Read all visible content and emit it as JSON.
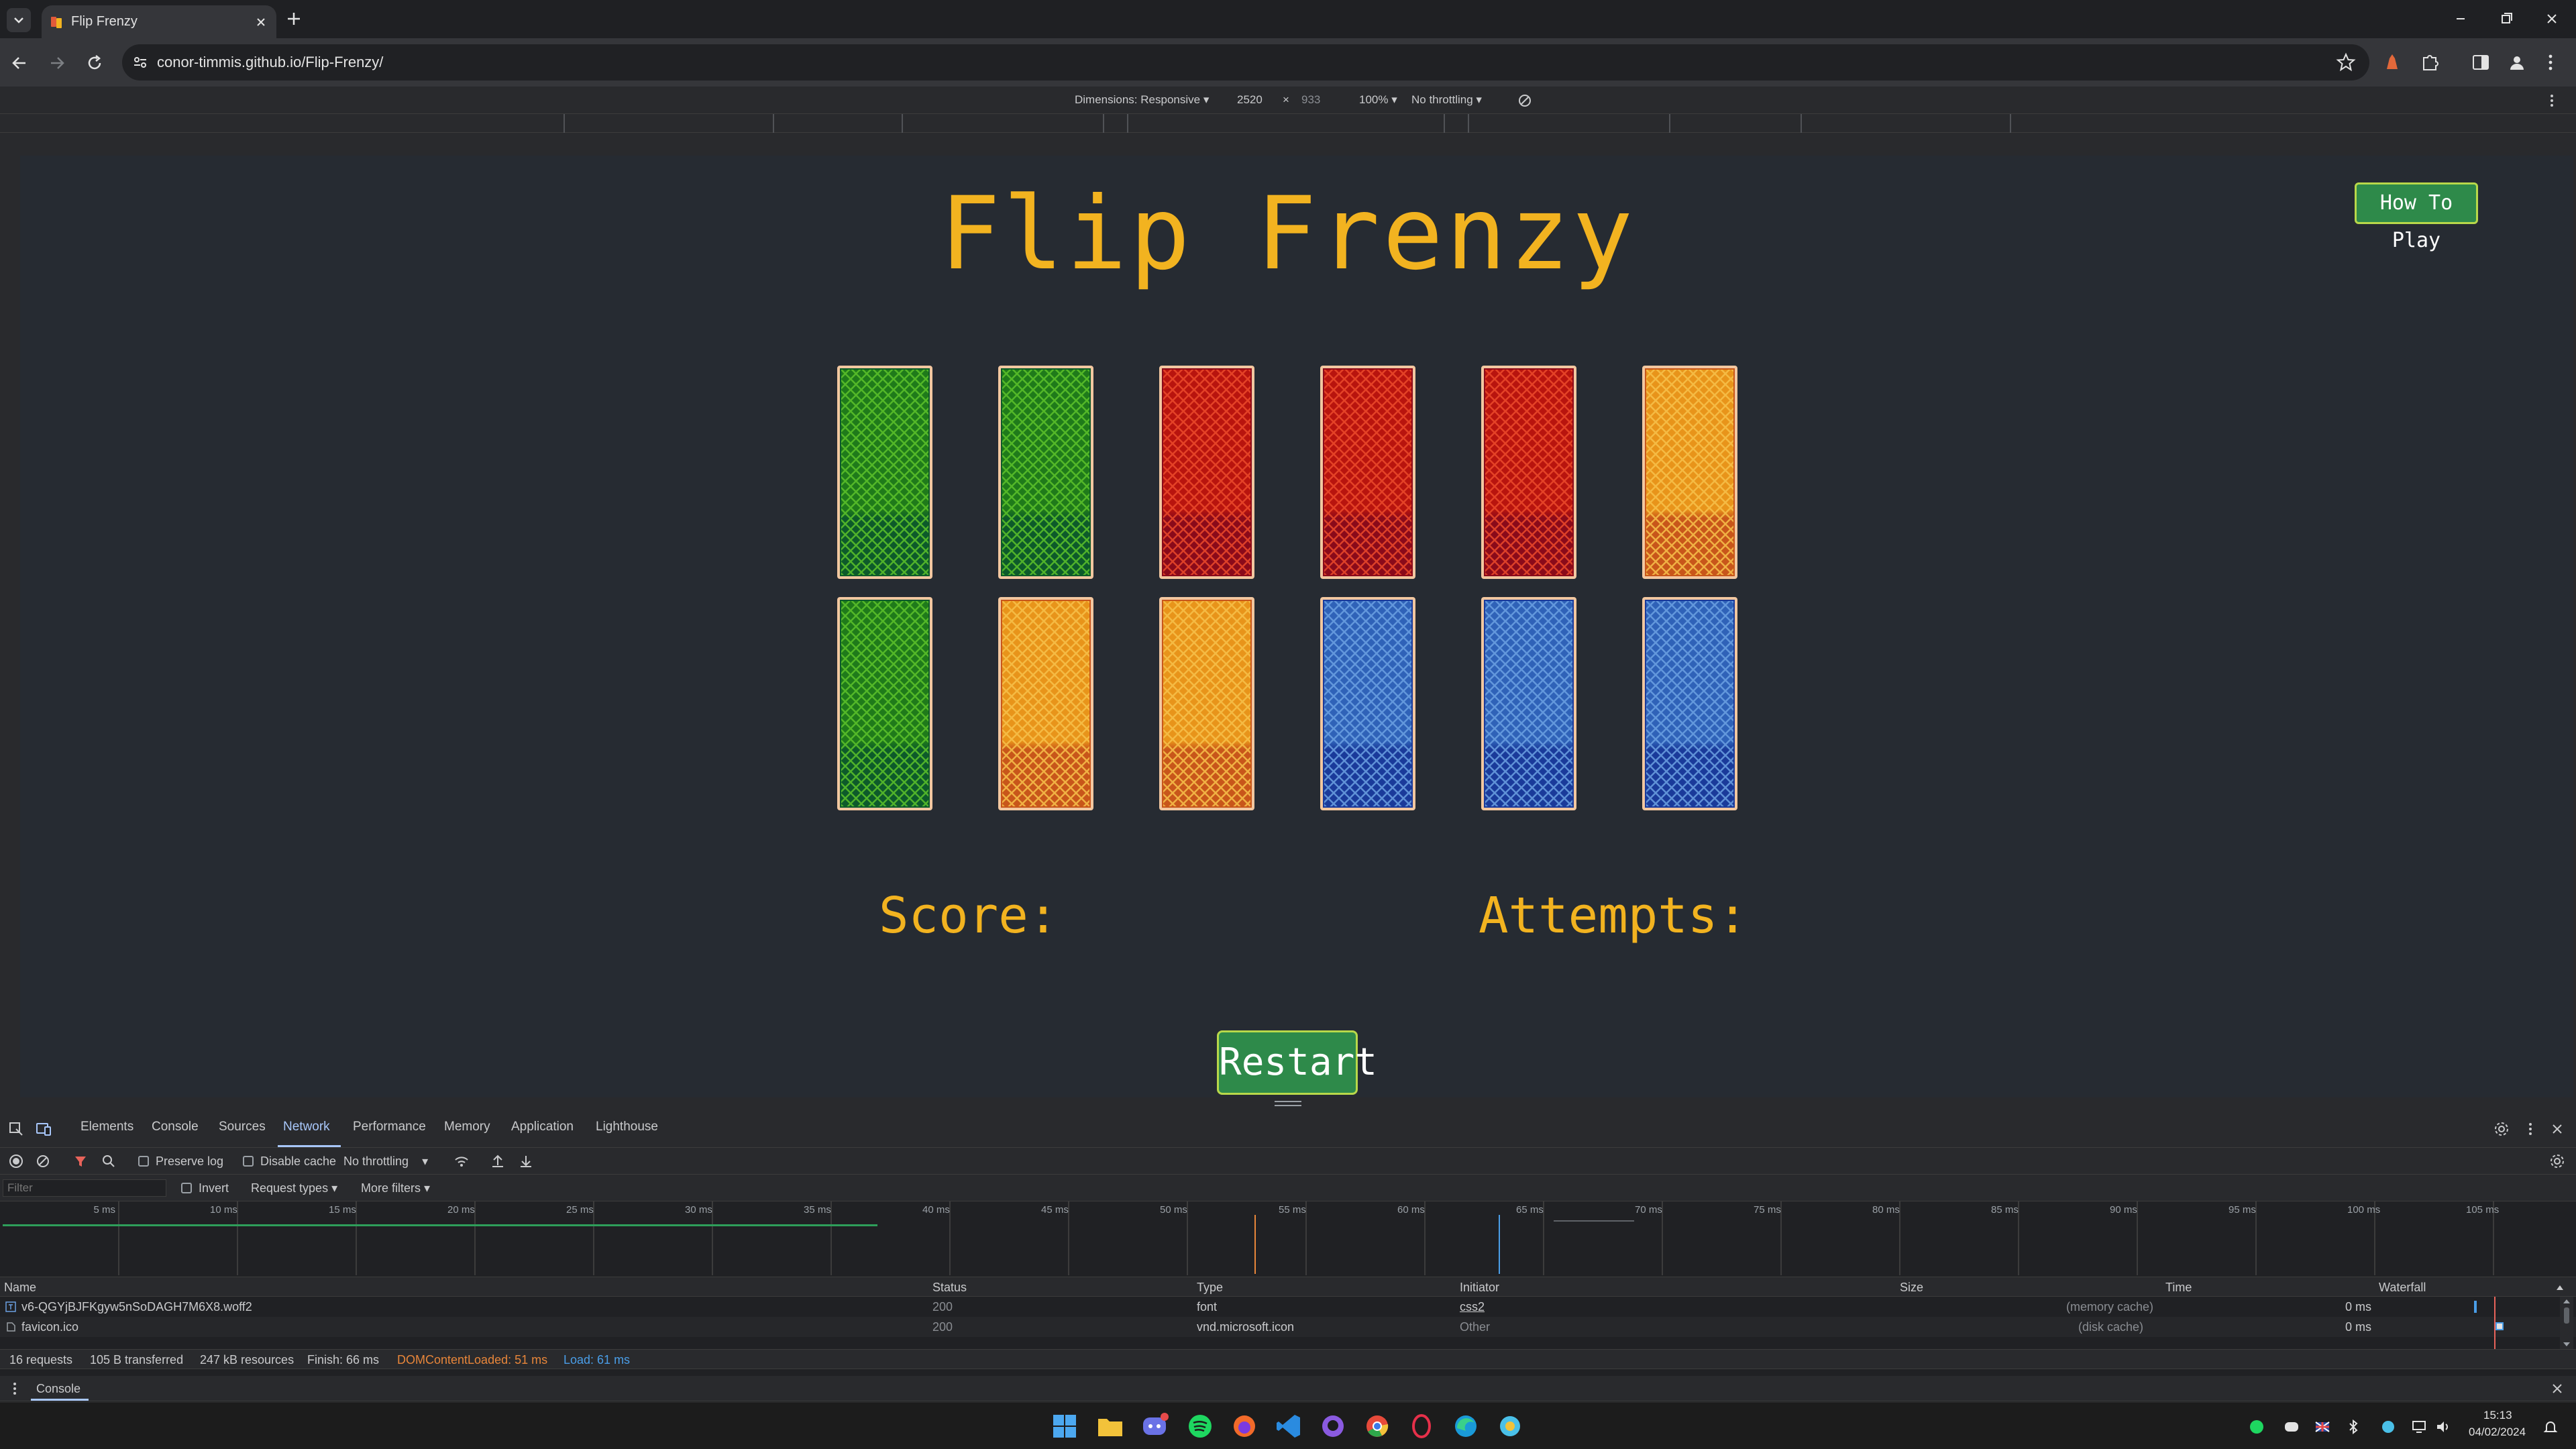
{
  "browser": {
    "tab_title": "Flip Frenzy",
    "url": "conor-timmis.github.io/Flip-Frenzy/"
  },
  "device_toolbar": {
    "dimensions_label": "Dimensions: Responsive",
    "width": "2520",
    "height": "933",
    "times": "×",
    "zoom": "100%",
    "throttling": "No throttling"
  },
  "game": {
    "title": "Flip Frenzy",
    "how_to_play": "How To Play",
    "score_label": "Score:",
    "attempts_label": "Attempts:",
    "restart": "Restart",
    "cards": [
      {
        "row": 1,
        "color": "green"
      },
      {
        "row": 1,
        "color": "green"
      },
      {
        "row": 1,
        "color": "red"
      },
      {
        "row": 1,
        "color": "red"
      },
      {
        "row": 1,
        "color": "red"
      },
      {
        "row": 1,
        "color": "orange"
      },
      {
        "row": 2,
        "color": "green"
      },
      {
        "row": 2,
        "color": "orange"
      },
      {
        "row": 2,
        "color": "orange"
      },
      {
        "row": 2,
        "color": "blue"
      },
      {
        "row": 2,
        "color": "blue"
      },
      {
        "row": 2,
        "color": "blue"
      }
    ],
    "card_colors": {
      "green": [
        "#1f7a1a",
        "#5cc22a",
        "#0d5a2a"
      ],
      "red": [
        "#b8140e",
        "#ec4a2a",
        "#8a0a1a"
      ],
      "orange": [
        "#e8941a",
        "#f7c14a",
        "#c8561a"
      ],
      "blue": [
        "#2f62b8",
        "#6ba0e2",
        "#1a3a9a"
      ]
    }
  },
  "devtools": {
    "tabs": [
      "Elements",
      "Console",
      "Sources",
      "Network",
      "Performance",
      "Memory",
      "Application",
      "Lighthouse"
    ],
    "active_tab": "Network",
    "preserve_log": "Preserve log",
    "disable_cache": "Disable cache",
    "throttling": "No throttling",
    "filter_placeholder": "Filter",
    "invert": "Invert",
    "request_types": "Request types",
    "more_filters": "More filters",
    "timeline_ticks": [
      "5 ms",
      "10 ms",
      "15 ms",
      "20 ms",
      "25 ms",
      "30 ms",
      "35 ms",
      "40 ms",
      "45 ms",
      "50 ms",
      "55 ms",
      "60 ms",
      "65 ms",
      "70 ms",
      "75 ms",
      "80 ms",
      "85 ms",
      "90 ms",
      "95 ms",
      "100 ms",
      "105 ms"
    ],
    "columns": [
      "Name",
      "Status",
      "Type",
      "Initiator",
      "Size",
      "Time",
      "Waterfall"
    ],
    "rows": [
      {
        "name": "v6-QGYjBJFKgyw5nSoDAGH7M6X8.woff2",
        "status": "200",
        "type": "font",
        "initiator": "css2",
        "size": "(memory cache)",
        "time": "0 ms"
      },
      {
        "name": "favicon.ico",
        "status": "200",
        "type": "vnd.microsoft.icon",
        "initiator": "Other",
        "size": "(disk cache)",
        "time": "0 ms"
      }
    ],
    "status_bar": {
      "requests": "16 requests",
      "transferred": "105 B transferred",
      "resources": "247 kB resources",
      "finish": "Finish: 66 ms",
      "dom_loaded": "DOMContentLoaded: 51 ms",
      "load": "Load: 61 ms"
    },
    "drawer_tab": "Console"
  },
  "taskbar": {
    "time": "15:13",
    "date": "04/02/2024"
  }
}
